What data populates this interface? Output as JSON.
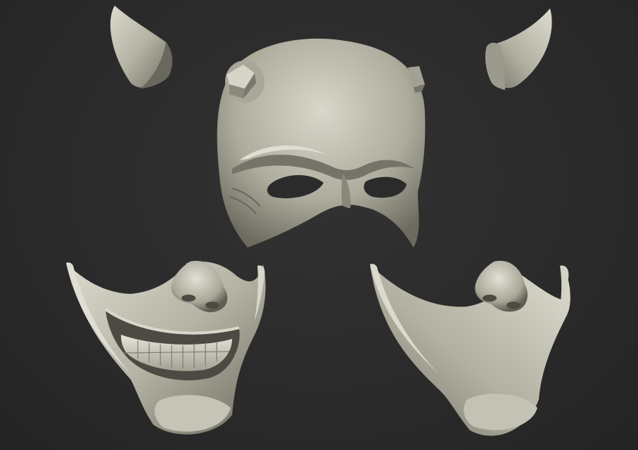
{
  "scene": {
    "background_color": "#2b2b2b",
    "material_color": "#b9b7a8",
    "shadow_color": "#6f6d62",
    "highlight_color": "#e4e2d6",
    "parts": [
      {
        "name": "left-horn"
      },
      {
        "name": "right-horn"
      },
      {
        "name": "upper-face-mask",
        "features": [
          "brow",
          "eye-holes",
          "nose-bridge",
          "side-pegs"
        ]
      },
      {
        "name": "lower-face-grinning-mask",
        "features": [
          "nose",
          "open-smile",
          "teeth",
          "chin"
        ]
      },
      {
        "name": "lower-face-closed-mask",
        "features": [
          "nose",
          "chin"
        ]
      }
    ]
  }
}
